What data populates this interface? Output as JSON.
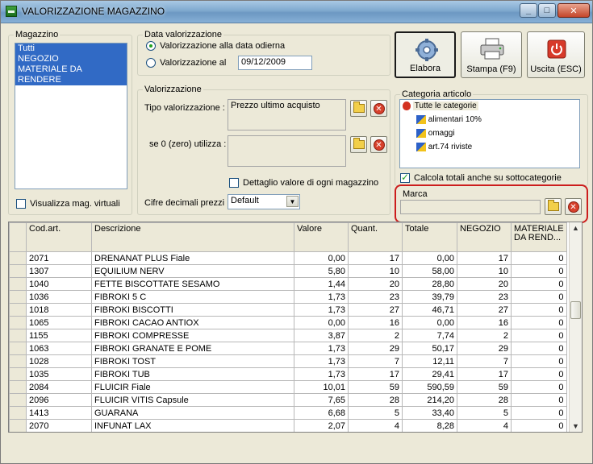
{
  "window": {
    "title": "VALORIZZAZIONE MAGAZZINO",
    "min": "_",
    "max": "□",
    "close": "✕"
  },
  "magazzino": {
    "legend": "Magazzino",
    "items": [
      "Tutti",
      "NEGOZIO",
      "MATERIALE DA RENDERE"
    ],
    "virtual_label": "Visualizza mag. virtuali"
  },
  "data_val": {
    "legend": "Data valorizzazione",
    "option_today": "Valorizzazione alla data odierna",
    "option_at": "Valorizzazione al",
    "date_value": "09/12/2009"
  },
  "valorizzazione": {
    "legend": "Valorizzazione",
    "tipo_label": "Tipo valorizzazione :",
    "tipo_value": "Prezzo ultimo acquisto",
    "zero_label": "se 0 (zero) utilizza :",
    "zero_value": "",
    "detail_label": "Dettaglio valore di ogni magazzino",
    "decimali_label": "Cifre decimali prezzi :",
    "decimali_value": "Default"
  },
  "toolbar": {
    "elabora": "Elabora",
    "stampa": "Stampa (F9)",
    "uscita": "Uscita (ESC)"
  },
  "categoria": {
    "legend": "Categoria articolo",
    "root": "Tutte le categorie",
    "children": [
      "alimentari 10%",
      "omaggi",
      "art.74 riviste"
    ],
    "subcat_label": "Calcola totali anche su sottocategorie"
  },
  "marca": {
    "legend": "Marca",
    "value": ""
  },
  "grid": {
    "headers": [
      "Cod.art.",
      "Descrizione",
      "Valore",
      "Quant.",
      "Totale",
      "NEGOZIO",
      "MATERIALE DA REND..."
    ],
    "rows": [
      [
        "2071",
        "DRENANAT PLUS Fiale",
        "0,00",
        "17",
        "0,00",
        "17",
        "0"
      ],
      [
        "1307",
        "EQUILIUM NERV",
        "5,80",
        "10",
        "58,00",
        "10",
        "0"
      ],
      [
        "1040",
        "FETTE BISCOTTATE SESAMO",
        "1,44",
        "20",
        "28,80",
        "20",
        "0"
      ],
      [
        "1036",
        "FIBROKI 5 C",
        "1,73",
        "23",
        "39,79",
        "23",
        "0"
      ],
      [
        "1018",
        "FIBROKI BISCOTTI",
        "1,73",
        "27",
        "46,71",
        "27",
        "0"
      ],
      [
        "1065",
        "FIBROKI CACAO ANTIOX",
        "0,00",
        "16",
        "0,00",
        "16",
        "0"
      ],
      [
        "1155",
        "FIBROKI COMPRESSE",
        "3,87",
        "2",
        "7,74",
        "2",
        "0"
      ],
      [
        "1063",
        "FIBROKI GRANATE E POME",
        "1,73",
        "29",
        "50,17",
        "29",
        "0"
      ],
      [
        "1028",
        "FIBROKI TOST",
        "1,73",
        "7",
        "12,11",
        "7",
        "0"
      ],
      [
        "1035",
        "FIBROKI TUB",
        "1,73",
        "17",
        "29,41",
        "17",
        "0"
      ],
      [
        "2084",
        "FLUICIR Fiale",
        "10,01",
        "59",
        "590,59",
        "59",
        "0"
      ],
      [
        "2096",
        "FLUICIR VITIS Capsule",
        "7,65",
        "28",
        "214,20",
        "28",
        "0"
      ],
      [
        "1413",
        "GUARANA",
        "6,68",
        "5",
        "33,40",
        "5",
        "0"
      ],
      [
        "2070",
        "INFUNAT LAX",
        "2,07",
        "4",
        "8,28",
        "4",
        "0"
      ]
    ]
  }
}
